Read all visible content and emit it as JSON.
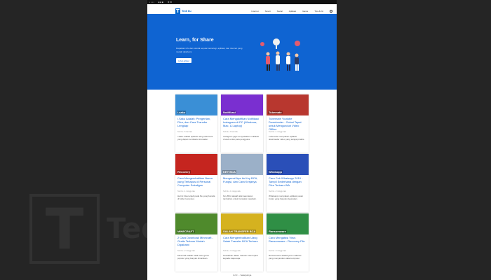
{
  "watermark": {
    "logo_letter": "T",
    "text": "Tedi"
  },
  "statusbar": {
    "items": [
      "• • • •",
      "■ ■ ■",
      "⚙ ⚙"
    ]
  },
  "site": {
    "logo_letter": "T",
    "logo_text": "Tedi Ilu"
  },
  "nav": [
    "Internet",
    "Smart",
    "Social",
    "Aplikasi",
    "Game",
    "Tips & Kit"
  ],
  "hero": {
    "title": "Learn, for Share",
    "subtitle": "Dapatkan info dan tutorial seputar teknologi, aplikasi, dan internet yang mudah dipahami.",
    "button": "Lihat artikel"
  },
  "colors": {
    "accent": "#0f64d2",
    "page_bg": "#252525"
  },
  "cards": [
    {
      "title": "i.Saku Adalah: Pengertian, Fitur, dan Cara Transfer Lengkap",
      "meta": "Tedi Ilu • 5 hari lalu",
      "excerpt": "i.Saku adalah aplikasi uang elektronik yang dapat membantu transaksi.",
      "thumb_text": "i.saku",
      "thumb_color": "#3a8fd6"
    },
    {
      "title": "Cara Mengaktifkan Notifikasi Instagram di PC (Windows, Mac, & Laptop)",
      "meta": "Tedi Ilu • 6 hari lalu",
      "excerpt": "Instagram juga menyediakan notifikasi di web untuk para pengguna.",
      "thumb_text": "Notifikasi",
      "thumb_color": "#7a2fd0"
    },
    {
      "title": "Tubemate Youtube Downloader - Solusi Tepat untuk Mengunduh Video Offline",
      "meta": "Tedi Ilu • 1 minggu lalu",
      "excerpt": "Tubemate merupakan aplikasi downloader video yang sangat praktis.",
      "thumb_text": "Tubemate",
      "thumb_color": "#b8372f"
    },
    {
      "title": "Cara Mengembalikan Nama yang Terhapus di Personal Computer Sekaligus",
      "meta": "Tedi Ilu • 1 minggu lalu",
      "excerpt": "Hal ini bisa terjadi pada file yang berada di folder komputer.",
      "thumb_text": "Recovery",
      "thumb_color": "#c5251f"
    },
    {
      "title": "Mengenal Apa itu Key BCA, Fungsi, dan Cara Kerjanya",
      "meta": "Tedi Ilu • 1 minggu lalu",
      "excerpt": "Key BCA adalah alat keamanan tambahan untuk transaksi nasabah.",
      "thumb_text": "KEY BCA",
      "thumb_color": "#9bb0c8"
    },
    {
      "title": "Cara Cek Whatsapp 2019 - Tampil Sederhana dengan Fitur Terbaru WA",
      "meta": "Tedi Ilu • 2 minggu lalu",
      "excerpt": "Whatsapp merupakan aplikasi pesan instan yang banyak digunakan.",
      "thumb_text": "Whatsapp",
      "thumb_color": "#2a4fb8"
    },
    {
      "title": "2 Cara Download Minecraft - Gratis Terbaru Mudah Dipahami",
      "meta": "Tedi Ilu • 2 minggu lalu",
      "excerpt": "Minecraft adalah salah satu game populer yang banyak dimainkan.",
      "thumb_text": "MINECRAFT",
      "thumb_color": "#4f8a2c"
    },
    {
      "title": "Cara Mengembalikan Uang Salah Transfer BCA Terbaru",
      "meta": "Tedi Ilu • 3 minggu lalu",
      "excerpt": "Kesalahan dalam transfer bisa terjadi kepada siapa saja.",
      "thumb_text": "SALAH TRANSFER BCA",
      "thumb_color": "#d5b21f"
    },
    {
      "title": "Cara Mengatasi Virus Ransomware - Recovery File",
      "meta": "Tedi Ilu • 3 minggu lalu",
      "excerpt": "Ransomware adalah jenis malware yang menyandera data komputer.",
      "thumb_text": "Ransomware",
      "thumb_color": "#2f8f45"
    }
  ],
  "pager": "1  2  3  ...  Selanjutnya"
}
